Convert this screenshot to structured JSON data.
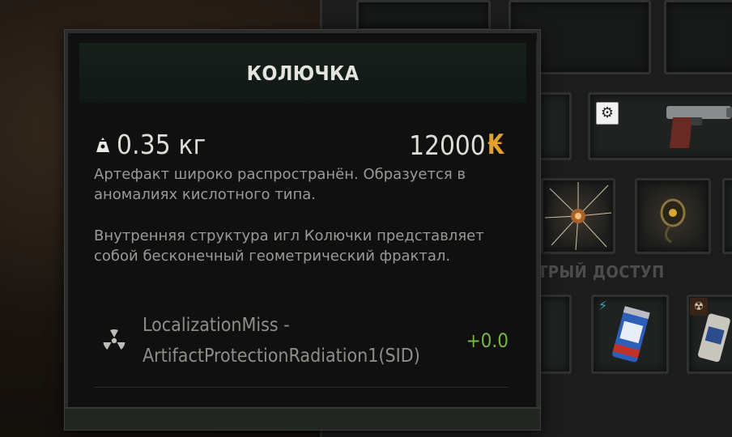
{
  "background_inventory": {
    "section_title": "ТРЫЙ ДОСТУП",
    "icons": [
      "gear-icon",
      "pistol-item",
      "artifact-item",
      "artifact-item",
      "energy-drink-item",
      "bolt-icon",
      "radiation-icon"
    ]
  },
  "tooltip": {
    "title": "КОЛЮЧКА",
    "weight": "0.35 кг",
    "price": "12000",
    "currency_symbol": "₭",
    "currency_color": "#e1a12c",
    "description_1": "Артефакт широко распространён. Образуется в аномалиях кислотного типа.",
    "description_2": "Внутренняя структура игл Колючки представляет собой бесконечный геометрический фрактал.",
    "stat": {
      "icon": "radiation-icon",
      "label": "LocalizationMiss - ArtifactProtectionRadiation1(SID)",
      "value": "+0.0",
      "value_color": "#78b545"
    }
  }
}
